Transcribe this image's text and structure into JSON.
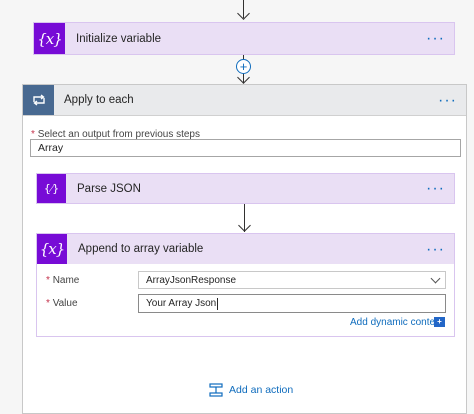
{
  "init_step": {
    "title": "Initialize variable",
    "icon": "curly-variable-icon",
    "more": "···"
  },
  "insert_step": {
    "icon": "plus-circle-icon",
    "glyph": "+"
  },
  "apply_each": {
    "title": "Apply to each",
    "icon": "loop-icon",
    "more": "···",
    "select_label": "Select an output from previous steps",
    "required_mark": "*",
    "select_value": "Array"
  },
  "parse_json": {
    "title": "Parse JSON",
    "icon": "json-curly-icon",
    "more": "···"
  },
  "append": {
    "title": "Append to array variable",
    "icon": "curly-variable-icon",
    "more": "···",
    "name_label": "Name",
    "name_value": "ArrayJsonResponse",
    "value_label": "Value",
    "value_value": "Your Array Json",
    "required_mark": "*",
    "dynamic_link": "Add dynamic content"
  },
  "add_action": {
    "label": "Add an action",
    "icon": "add-action-icon"
  },
  "colors": {
    "variable_purple": "#770bd6",
    "loop_gray": "#486991",
    "header_lavender": "#eadff5",
    "link_blue": "#0f6cbd"
  }
}
